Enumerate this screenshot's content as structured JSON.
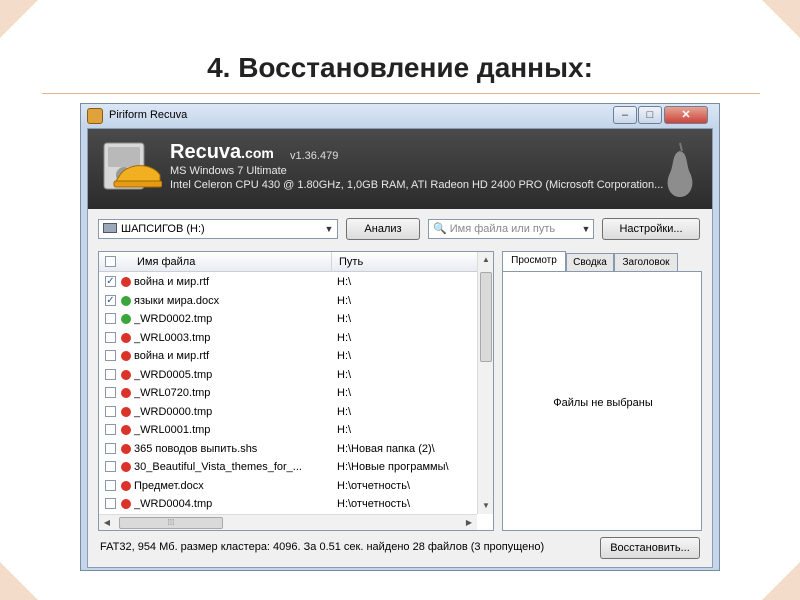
{
  "slide": {
    "title": "4. Восстановление данных:"
  },
  "window": {
    "title": "Piriform Recuva",
    "min": "–",
    "max": "□",
    "close": "✕"
  },
  "header": {
    "brand": "Recuva",
    "brand_suffix": ".com",
    "version": "v1.36.479",
    "os": "MS Windows 7 Ultimate",
    "hardware": "Intel Celeron CPU 430 @ 1.80GHz, 1,0GB RAM, ATI Radeon HD 2400 PRO (Microsoft Corporation..."
  },
  "toolbar": {
    "drive": "ШАПСИГОВ (H:)",
    "analyze": "Анализ",
    "search_placeholder": "Имя файла или путь",
    "settings": "Настройки..."
  },
  "file_list": {
    "col_name": "Имя файла",
    "col_path": "Путь",
    "rows": [
      {
        "checked": "✓",
        "state": "red",
        "name": "война и мир.rtf",
        "path": "H:\\"
      },
      {
        "checked": "✓",
        "state": "green",
        "name": "языки мира.docx",
        "path": "H:\\"
      },
      {
        "checked": "",
        "state": "green",
        "name": "_WRD0002.tmp",
        "path": "H:\\"
      },
      {
        "checked": "",
        "state": "red",
        "name": "_WRL0003.tmp",
        "path": "H:\\"
      },
      {
        "checked": "",
        "state": "red",
        "name": "война и мир.rtf",
        "path": "H:\\"
      },
      {
        "checked": "",
        "state": "red",
        "name": "_WRD0005.tmp",
        "path": "H:\\"
      },
      {
        "checked": "",
        "state": "red",
        "name": "_WRL0720.tmp",
        "path": "H:\\"
      },
      {
        "checked": "",
        "state": "red",
        "name": "_WRD0000.tmp",
        "path": "H:\\"
      },
      {
        "checked": "",
        "state": "red",
        "name": "_WRL0001.tmp",
        "path": "H:\\"
      },
      {
        "checked": "",
        "state": "red",
        "name": "365 поводов выпить.shs",
        "path": "H:\\Новая папка (2)\\"
      },
      {
        "checked": "",
        "state": "red",
        "name": "30_Beautiful_Vista_themes_for_...",
        "path": "H:\\Новые программы\\"
      },
      {
        "checked": "",
        "state": "red",
        "name": "Предмет.docx",
        "path": "H:\\отчетность\\"
      },
      {
        "checked": "",
        "state": "red",
        "name": "_WRD0004.tmp",
        "path": "H:\\отчетность\\"
      }
    ]
  },
  "tabs": {
    "preview": "Просмотр",
    "summary": "Сводка",
    "header": "Заголовок"
  },
  "preview": {
    "empty": "Файлы не выбраны"
  },
  "status": {
    "text": "FAT32, 954 Мб. размер кластера: 4096. За 0.51 сек. найдено 28 файлов (3 пропущено)",
    "restore": "Восстановить..."
  },
  "colors": {
    "accent_line": "#e8b48c",
    "corner": "#f3dcc9",
    "header_bg": "#2c2c2c",
    "state_red": "#d9332a",
    "state_green": "#3aa63a"
  },
  "icons": {
    "drive": "drive-icon",
    "search": "magnifier-icon",
    "logo": "recuva-hardhat-logo",
    "pear": "piriform-pear-logo"
  }
}
